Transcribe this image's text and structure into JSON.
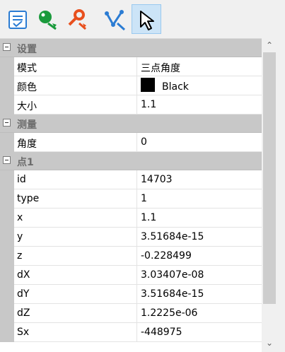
{
  "toolbar": {
    "buttons": [
      {
        "name": "properties-icon",
        "active": false
      },
      {
        "name": "add-point-icon",
        "active": false
      },
      {
        "name": "edit-point-icon",
        "active": false
      },
      {
        "name": "measure-angle-icon",
        "active": false
      },
      {
        "name": "select-cursor-icon",
        "active": true
      }
    ]
  },
  "grid": {
    "settings": {
      "title": "设置",
      "mode_label": "模式",
      "mode_value": "三点角度",
      "color_label": "颜色",
      "color_value": "Black",
      "color_hex": "#000000",
      "size_label": "大小",
      "size_value": "1.1"
    },
    "measure": {
      "title": "测量",
      "angle_label": "角度",
      "angle_value": "0"
    },
    "point1": {
      "title": "点1",
      "rows": [
        {
          "label": "id",
          "value": "14703"
        },
        {
          "label": "type",
          "value": "1"
        },
        {
          "label": "x",
          "value": "1.1"
        },
        {
          "label": "y",
          "value": "3.51684e-15"
        },
        {
          "label": "z",
          "value": "-0.228499"
        },
        {
          "label": "dX",
          "value": "3.03407e-08"
        },
        {
          "label": "dY",
          "value": "3.51684e-15"
        },
        {
          "label": "dZ",
          "value": "1.2225e-06"
        },
        {
          "label": "Sx",
          "value": "-448975"
        }
      ]
    }
  },
  "colors": {
    "category_bg": "#c8c8c8",
    "active_button": "#cce4f7",
    "icon_blue": "#2b7cd3",
    "icon_green": "#1a9a3c",
    "icon_red": "#e8501e"
  }
}
